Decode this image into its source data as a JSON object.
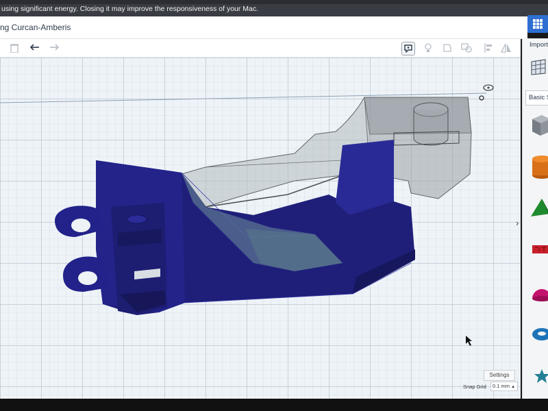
{
  "notification": {
    "message": "using significant energy. Closing it may improve the responsiveness of your Mac."
  },
  "header": {
    "title": "ng Curcan-Amberis"
  },
  "right_panel": {
    "import_label": "Import",
    "shape_category": "Basic S",
    "shapes": [
      "box-shape-icon",
      "cylinder-shape-icon",
      "roof-shape-icon",
      "text-shape-icon",
      "half-sphere-shape-icon",
      "torus-shape-icon",
      "star-shape-icon"
    ]
  },
  "canvas": {
    "settings_label": "Settings",
    "snap_grid_label": "Snap Grid",
    "snap_grid_value": "0.1 mm",
    "expand_glyph": "›"
  },
  "colors": {
    "accent": "#2f6fd1",
    "workplane": "#eef3f7",
    "solid_navy": "#1f1f7a",
    "hole_gray": "#9aa0a6"
  },
  "toolbar": {
    "icons": [
      "trash-icon",
      "undo-icon",
      "redo-icon",
      "note-icon",
      "bulb-icon",
      "shape-icon",
      "group-icon",
      "align-icon",
      "mirror-icon"
    ]
  }
}
